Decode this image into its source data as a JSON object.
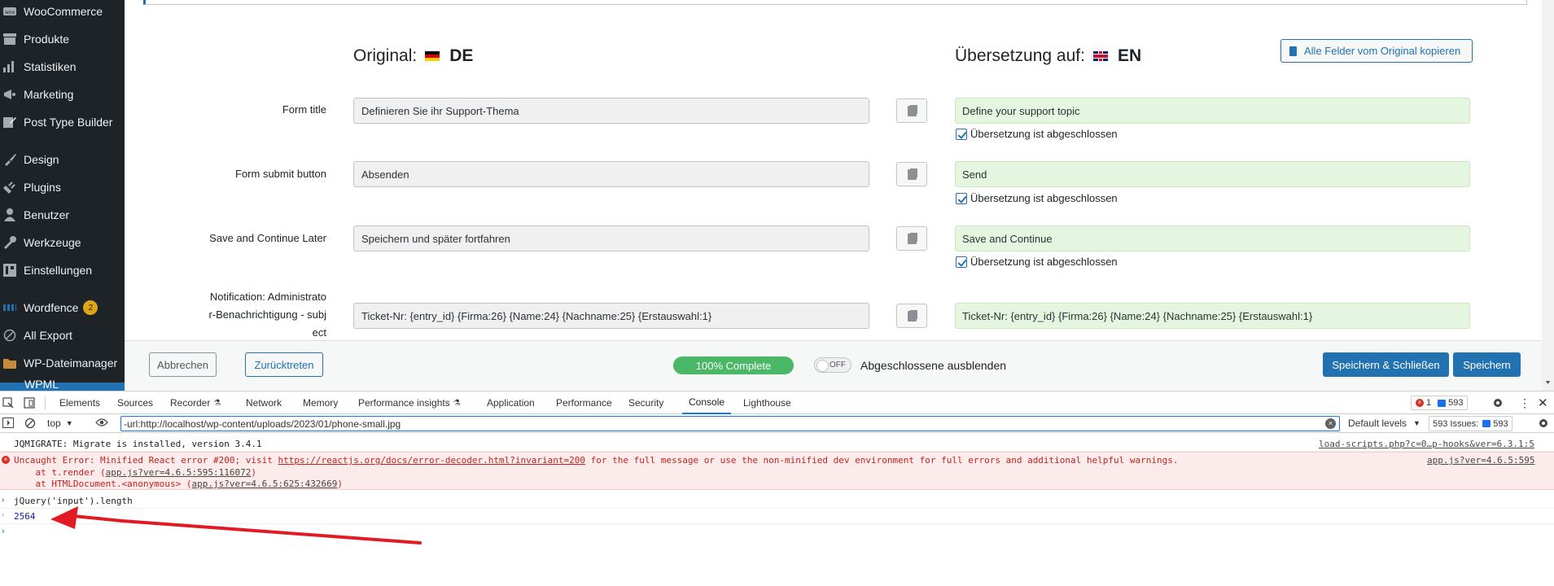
{
  "sidebar": {
    "items": [
      {
        "label": "WooCommerce",
        "icon": "woocommerce-icon"
      },
      {
        "label": "Produkte",
        "icon": "archive-icon"
      },
      {
        "label": "Statistiken",
        "icon": "bar-chart-icon"
      },
      {
        "label": "Marketing",
        "icon": "megaphone-icon"
      },
      {
        "label": "Post Type Builder",
        "icon": "edit-icon"
      },
      {
        "label": "Design",
        "icon": "paintbrush-icon"
      },
      {
        "label": "Plugins",
        "icon": "plugin-icon"
      },
      {
        "label": "Benutzer",
        "icon": "user-icon"
      },
      {
        "label": "Werkzeuge",
        "icon": "wrench-icon"
      },
      {
        "label": "Einstellungen",
        "icon": "settings-icon"
      },
      {
        "label": "Wordfence",
        "icon": "wordfence-icon",
        "badge": "2"
      },
      {
        "label": "All Export",
        "icon": "export-icon"
      },
      {
        "label": "WP-Dateimanager",
        "icon": "folder-icon"
      },
      {
        "label": "WPML",
        "icon": "wpml-icon"
      }
    ]
  },
  "editor": {
    "original_label": "Original:",
    "original_lang": "DE",
    "translation_label": "Übersetzung auf:",
    "translation_lang": "EN",
    "copy_all_label": "Alle Felder vom Original kopieren",
    "fields": [
      {
        "label": "Form title",
        "original": "Definieren Sie ihr Support-Thema",
        "translation": "Define your support topic",
        "complete_label": "Übersetzung ist abgeschlossen"
      },
      {
        "label": "Form submit button",
        "original": "Absenden",
        "translation": "Send",
        "complete_label": "Übersetzung ist abgeschlossen"
      },
      {
        "label": "Save and Continue Later",
        "original": "Speichern und später fortfahren",
        "translation": "Save and Continue",
        "complete_label": "Übersetzung ist abgeschlossen"
      },
      {
        "label_lines": [
          "Notification: Administrato",
          "r-Benachrichtigung - subj",
          "ect"
        ],
        "original": "Ticket-Nr: {entry_id} {Firma:26} {Name:24} {Nachname:25} {Erstauswahl:1}",
        "translation": "Ticket-Nr: {entry_id} {Firma:26} {Name:24} {Nachname:25} {Erstauswahl:1}"
      }
    ]
  },
  "footer": {
    "cancel_label": "Abbrechen",
    "back_label": "Zurücktreten",
    "progress_label": "100% Complete",
    "progress_value": 100,
    "toggle_state": "OFF",
    "hide_completed_label": "Abgeschlossene ausblenden",
    "save_close_label": "Speichern & Schließen",
    "save_label": "Speichern"
  },
  "devtools": {
    "tabs": [
      "Elements",
      "Sources",
      "Recorder",
      "Network",
      "Memory",
      "Performance insights",
      "Application",
      "Performance",
      "Security",
      "Console",
      "Lighthouse"
    ],
    "active_tab": "Console",
    "error_count": "1",
    "message_count": "593",
    "context": "top",
    "filter_value": "-url:http://localhost/wp-content/uploads/2023/01/phone-small.jpg",
    "levels_label": "Default levels",
    "issues_label": "593 Issues:",
    "issues_count": "593",
    "console": {
      "jqmigrate_text": "JQMIGRATE: Migrate is installed, version 3.4.1",
      "jqmigrate_source": "load-scripts.php?c=0…p-hooks&ver=6.3.1:5",
      "error_prefix": "Uncaught Error: Minified React error #200; visit ",
      "error_link": "https://reactjs.org/docs/error-decoder.html?invariant=200",
      "error_suffix": " for the full message or use the non-minified dev environment for full errors and additional helpful warnings.",
      "error_source": "app.js?ver=4.6.5:595",
      "stack1_prefix": "    at t.render (",
      "stack1_link": "app.js?ver=4.6.5:595:116072",
      "stack1_suffix": ")",
      "stack2_prefix": "    at HTMLDocument.<anonymous> (",
      "stack2_link": "app.js?ver=4.6.5:625:432669",
      "stack2_suffix": ")",
      "input": "jQuery('input').length",
      "result": "2564"
    }
  },
  "colors": {
    "annotation_arrow": "#e01b24",
    "accent": "#2271b1",
    "progress": "#4ab866"
  }
}
